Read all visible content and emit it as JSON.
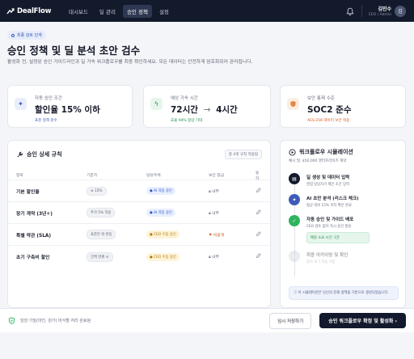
{
  "app": {
    "name": "DealFlow"
  },
  "nav": {
    "tabs": [
      {
        "label": "대시보드",
        "active": false
      },
      {
        "label": "딜 관리",
        "active": false
      },
      {
        "label": "승인 정책",
        "active": true
      },
      {
        "label": "설정",
        "active": false
      }
    ],
    "user": {
      "name": "김민수",
      "role": "CEO / Admin",
      "avatar": "김"
    }
  },
  "header": {
    "stage": "최종 검토 단계",
    "title": "승인 정책 및 딜 분석 초안 검수",
    "description": "활성화 전, 설정된 승인 가이드라인과 딜 가속 워크플로우를 최종 확인하세요. 모든 데이터는 안전하게 암호화되어 관리됩니다."
  },
  "stats": [
    {
      "icon": "sparkle-icon",
      "label": "자동 승인 조건",
      "value": "할인율 15% 이하",
      "sub": "표준 정책 준수",
      "color": "#3e5bb7"
    },
    {
      "icon": "lightning-icon",
      "label": "예상 가속 시간",
      "value_from": "72시간",
      "arrow": "→",
      "value_to": "4시간",
      "sub": "효율 94% 향상 기대",
      "color": "#23894a"
    },
    {
      "icon": "shield-icon",
      "label": "보안 통제 수준",
      "value": "SOC2 준수",
      "sub": "AES-256 데이터 보안 적용",
      "color": "#d8541f"
    }
  ],
  "rules": {
    "title": "승인 상세 규칙",
    "action": "총 4개 규칙 적용됨",
    "columns": [
      "항목",
      "기준치",
      "담당주체",
      "보안 등급",
      "동작"
    ],
    "rows": [
      {
        "item": "기본 할인율",
        "threshold": "≤ 15%",
        "owner": "AI 자동 승인",
        "owner_type": "ai",
        "security": "내부"
      },
      {
        "item": "장기 계약 (3년+)",
        "threshold": "추가 5% 허용",
        "owner": "AI 자동 승인",
        "owner_type": "ai",
        "security": "내부"
      },
      {
        "item": "특별 약관 (SLA)",
        "threshold": "표준안 외 변동",
        "owner": "CEO 수동 승인",
        "owner_type": "ceo",
        "security": "비공개"
      },
      {
        "item": "초기 구축비 할인",
        "threshold": "전액 면제 시",
        "owner": "CEO 수동 승인",
        "owner_type": "ceo",
        "security": "내부"
      }
    ]
  },
  "workflow": {
    "title": "워크플로우 시뮬레이션",
    "subtitle": "예시 딜: $50,000 엔터프라이즈 계약",
    "steps": [
      {
        "title": "딜 생성 및 데이터 입력",
        "desc": "영업 담당자가 제안 조건 입력",
        "color": "#141a2d",
        "icon": "document-icon"
      },
      {
        "title": "AI 초안 분석 (리스크 체크)",
        "desc": "평균 대비 15% 이하 확인 완료",
        "color": "#3e5bb7",
        "icon": "robot-icon"
      },
      {
        "title": "자동 승인 및 가이드 배포",
        "desc": "CEO 검토 없이 즉시 승인 발송",
        "color": "#2fb35f",
        "icon": "check-icon",
        "box": "배송 소요 시간: 1분"
      },
      {
        "title": "최종 아카이빙 및 확인",
        "desc": "감사 로그 자동 저장",
        "color": "#c9ced8",
        "icon": "archive-icon",
        "faded": true
      }
    ],
    "note": "이 시뮬레이션은 당신의 현재 정책을 기반으로 생성되었습니다."
  },
  "footer": {
    "notice": "암암 기밀(마진, 원가) 비식별 처리 완료됨",
    "draft_button": "임시 저장하기",
    "main_button": "승인 워크플로우 확정 및 활성화",
    "main_arrow": "›"
  },
  "colors": {
    "nav_bg": "#131a2c",
    "accent": "#3e5bb7",
    "success": "#23894a",
    "warning": "#d8541f"
  }
}
